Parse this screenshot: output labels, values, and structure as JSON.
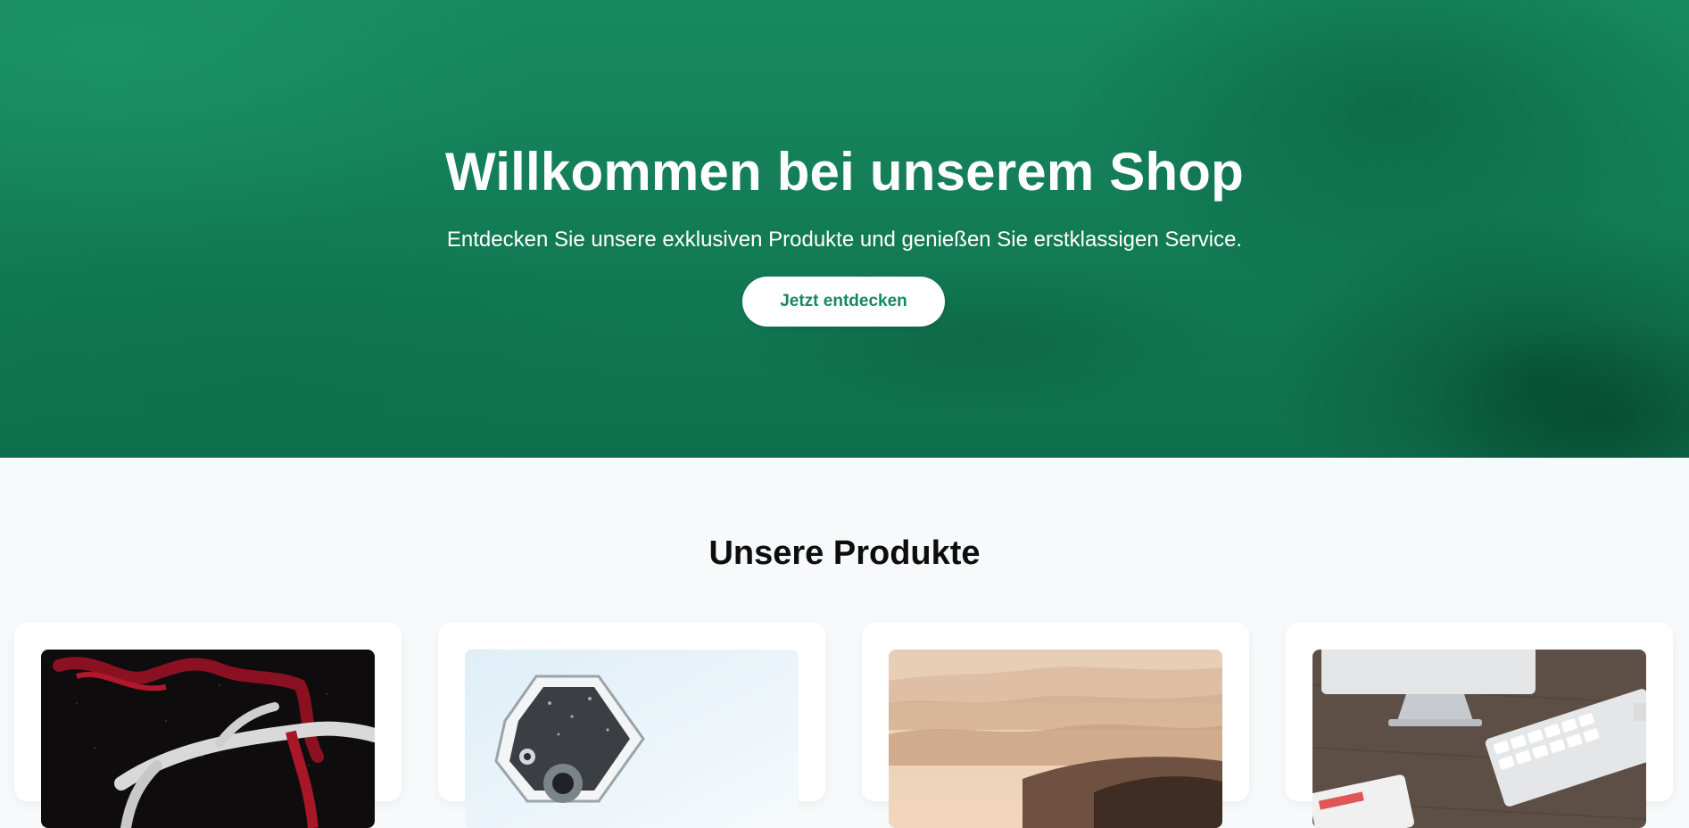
{
  "hero": {
    "title": "Willkommen bei unserem Shop",
    "subtitle": "Entdecken Sie unsere exklusiven Produkte und genießen Sie erstklassigen Service.",
    "cta_label": "Jetzt entdecken",
    "background_color": "#138a5e",
    "cta_text_color": "#138a5e"
  },
  "products_section": {
    "title": "Unsere Produkte",
    "items": [
      {
        "image": "antler-with-red-ribbon-image"
      },
      {
        "image": "security-camera-image"
      },
      {
        "image": "misty-mountains-image"
      },
      {
        "image": "desk-computer-keyboard-image"
      }
    ]
  }
}
